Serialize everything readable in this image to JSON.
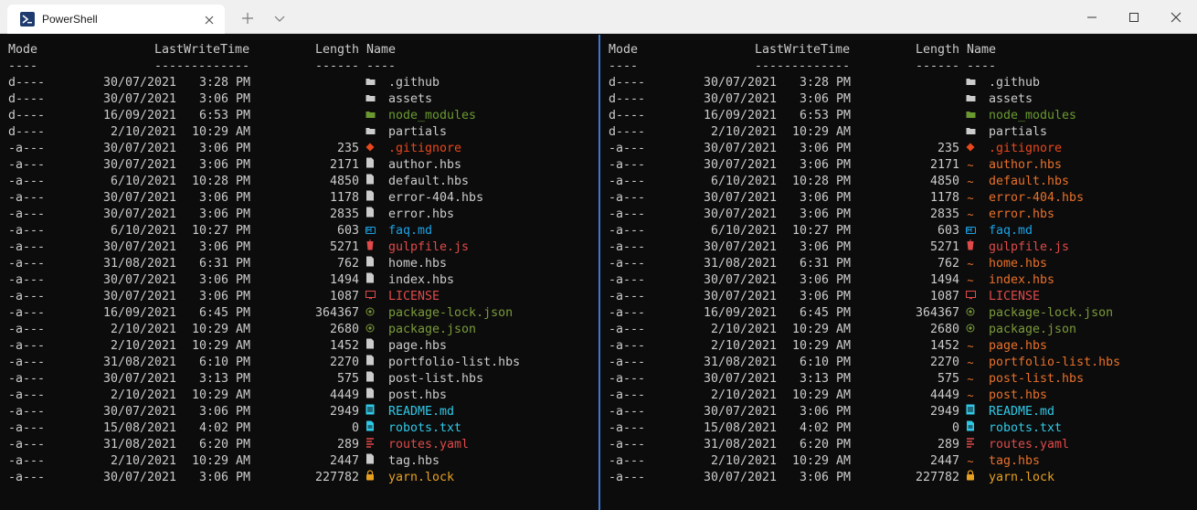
{
  "window": {
    "tab_title": "PowerShell"
  },
  "colors": {
    "default": "#cccccc",
    "node_modules": "#6a9a2f",
    "gitignore": "#e8481c",
    "markdown": "#1aa3e8",
    "gulp": "#e04a4a",
    "license": "#e04a4a",
    "json": "#7a9a3a",
    "readme": "#2fc9e8",
    "robots": "#2fc9e8",
    "yaml": "#e04a4a",
    "yarn": "#e8a020",
    "hbs_right": "#e8702a"
  },
  "header": {
    "mode": "Mode",
    "lastwritetime": "LastWriteTime",
    "length": "Length",
    "name": "Name",
    "mode_sep": "----",
    "lwt_sep": "-------------",
    "length_sep": "------",
    "name_sep": "----"
  },
  "entries": [
    {
      "mode": "d----",
      "date": "30/07/2021",
      "time": "3:28 PM",
      "length": "",
      "icon": "folder-icon",
      "name": ".github",
      "color": "default",
      "right_color": "default"
    },
    {
      "mode": "d----",
      "date": "30/07/2021",
      "time": "3:06 PM",
      "length": "",
      "icon": "folder-icon",
      "name": "assets",
      "color": "default",
      "right_color": "default"
    },
    {
      "mode": "d----",
      "date": "16/09/2021",
      "time": "6:53 PM",
      "length": "",
      "icon": "folder-icon",
      "name": "node_modules",
      "color": "node_modules",
      "right_color": "node_modules"
    },
    {
      "mode": "d----",
      "date": "2/10/2021",
      "time": "10:29 AM",
      "length": "",
      "icon": "folder-icon",
      "name": "partials",
      "color": "default",
      "right_color": "default"
    },
    {
      "mode": "-a---",
      "date": "30/07/2021",
      "time": "3:06 PM",
      "length": "235",
      "icon": "git-icon",
      "name": ".gitignore",
      "color": "gitignore",
      "right_color": "gitignore"
    },
    {
      "mode": "-a---",
      "date": "30/07/2021",
      "time": "3:06 PM",
      "length": "2171",
      "icon": "file-icon",
      "name": "author.hbs",
      "color": "default",
      "right_color": "hbs_right"
    },
    {
      "mode": "-a---",
      "date": "6/10/2021",
      "time": "10:28 PM",
      "length": "4850",
      "icon": "file-icon",
      "name": "default.hbs",
      "color": "default",
      "right_color": "hbs_right"
    },
    {
      "mode": "-a---",
      "date": "30/07/2021",
      "time": "3:06 PM",
      "length": "1178",
      "icon": "file-icon",
      "name": "error-404.hbs",
      "color": "default",
      "right_color": "hbs_right"
    },
    {
      "mode": "-a---",
      "date": "30/07/2021",
      "time": "3:06 PM",
      "length": "2835",
      "icon": "file-icon",
      "name": "error.hbs",
      "color": "default",
      "right_color": "hbs_right"
    },
    {
      "mode": "-a---",
      "date": "6/10/2021",
      "time": "10:27 PM",
      "length": "603",
      "icon": "markdown-icon",
      "name": "faq.md",
      "color": "markdown",
      "right_color": "markdown"
    },
    {
      "mode": "-a---",
      "date": "30/07/2021",
      "time": "3:06 PM",
      "length": "5271",
      "icon": "gulp-icon",
      "name": "gulpfile.js",
      "color": "gulp",
      "right_color": "gulp"
    },
    {
      "mode": "-a---",
      "date": "31/08/2021",
      "time": "6:31 PM",
      "length": "762",
      "icon": "file-icon",
      "name": "home.hbs",
      "color": "default",
      "right_color": "hbs_right"
    },
    {
      "mode": "-a---",
      "date": "30/07/2021",
      "time": "3:06 PM",
      "length": "1494",
      "icon": "file-icon",
      "name": "index.hbs",
      "color": "default",
      "right_color": "hbs_right"
    },
    {
      "mode": "-a---",
      "date": "30/07/2021",
      "time": "3:06 PM",
      "length": "1087",
      "icon": "license-icon",
      "name": "LICENSE",
      "color": "license",
      "right_color": "license"
    },
    {
      "mode": "-a---",
      "date": "16/09/2021",
      "time": "6:45 PM",
      "length": "364367",
      "icon": "json-icon",
      "name": "package-lock.json",
      "color": "json",
      "right_color": "json"
    },
    {
      "mode": "-a---",
      "date": "2/10/2021",
      "time": "10:29 AM",
      "length": "2680",
      "icon": "json-icon",
      "name": "package.json",
      "color": "json",
      "right_color": "json"
    },
    {
      "mode": "-a---",
      "date": "2/10/2021",
      "time": "10:29 AM",
      "length": "1452",
      "icon": "file-icon",
      "name": "page.hbs",
      "color": "default",
      "right_color": "hbs_right"
    },
    {
      "mode": "-a---",
      "date": "31/08/2021",
      "time": "6:10 PM",
      "length": "2270",
      "icon": "file-icon",
      "name": "portfolio-list.hbs",
      "color": "default",
      "right_color": "hbs_right"
    },
    {
      "mode": "-a---",
      "date": "30/07/2021",
      "time": "3:13 PM",
      "length": "575",
      "icon": "file-icon",
      "name": "post-list.hbs",
      "color": "default",
      "right_color": "hbs_right"
    },
    {
      "mode": "-a---",
      "date": "2/10/2021",
      "time": "10:29 AM",
      "length": "4449",
      "icon": "file-icon",
      "name": "post.hbs",
      "color": "default",
      "right_color": "hbs_right"
    },
    {
      "mode": "-a---",
      "date": "30/07/2021",
      "time": "3:06 PM",
      "length": "2949",
      "icon": "readme-icon",
      "name": "README.md",
      "color": "readme",
      "right_color": "readme"
    },
    {
      "mode": "-a---",
      "date": "15/08/2021",
      "time": "4:02 PM",
      "length": "0",
      "icon": "text-file-icon",
      "name": "robots.txt",
      "color": "robots",
      "right_color": "robots"
    },
    {
      "mode": "-a---",
      "date": "31/08/2021",
      "time": "6:20 PM",
      "length": "289",
      "icon": "yaml-icon",
      "name": "routes.yaml",
      "color": "yaml",
      "right_color": "yaml"
    },
    {
      "mode": "-a---",
      "date": "2/10/2021",
      "time": "10:29 AM",
      "length": "2447",
      "icon": "file-icon",
      "name": "tag.hbs",
      "color": "default",
      "right_color": "hbs_right"
    },
    {
      "mode": "-a---",
      "date": "30/07/2021",
      "time": "3:06 PM",
      "length": "227782",
      "icon": "lock-icon",
      "name": "yarn.lock",
      "color": "yarn",
      "right_color": "yarn"
    }
  ]
}
